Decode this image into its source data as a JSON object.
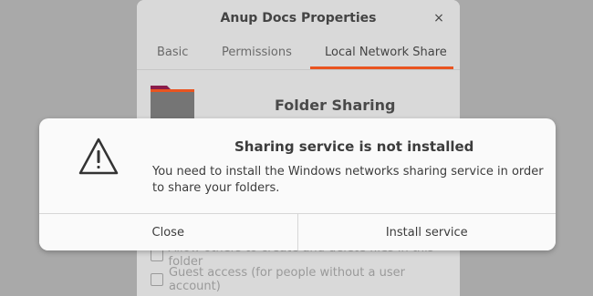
{
  "props_window": {
    "title": "Anup Docs Properties",
    "close_glyph": "×",
    "tabs": [
      {
        "label": "Basic"
      },
      {
        "label": "Permissions"
      },
      {
        "label": "Local Network Share"
      }
    ],
    "active_tab": "Local Network Share",
    "accent_color": "#e95420",
    "folder_heading": "Folder Sharing",
    "options": [
      {
        "label": "Allow others to create and delete files in this folder",
        "checked": false
      },
      {
        "label": "Guest access (for people without a user account)",
        "checked": false
      }
    ]
  },
  "dialog": {
    "icon": "warning-icon",
    "title": "Sharing service is not installed",
    "message": "You need to install the Windows networks sharing service in order to share your folders.",
    "buttons": {
      "close_label": "Close",
      "install_label": "Install service"
    }
  }
}
